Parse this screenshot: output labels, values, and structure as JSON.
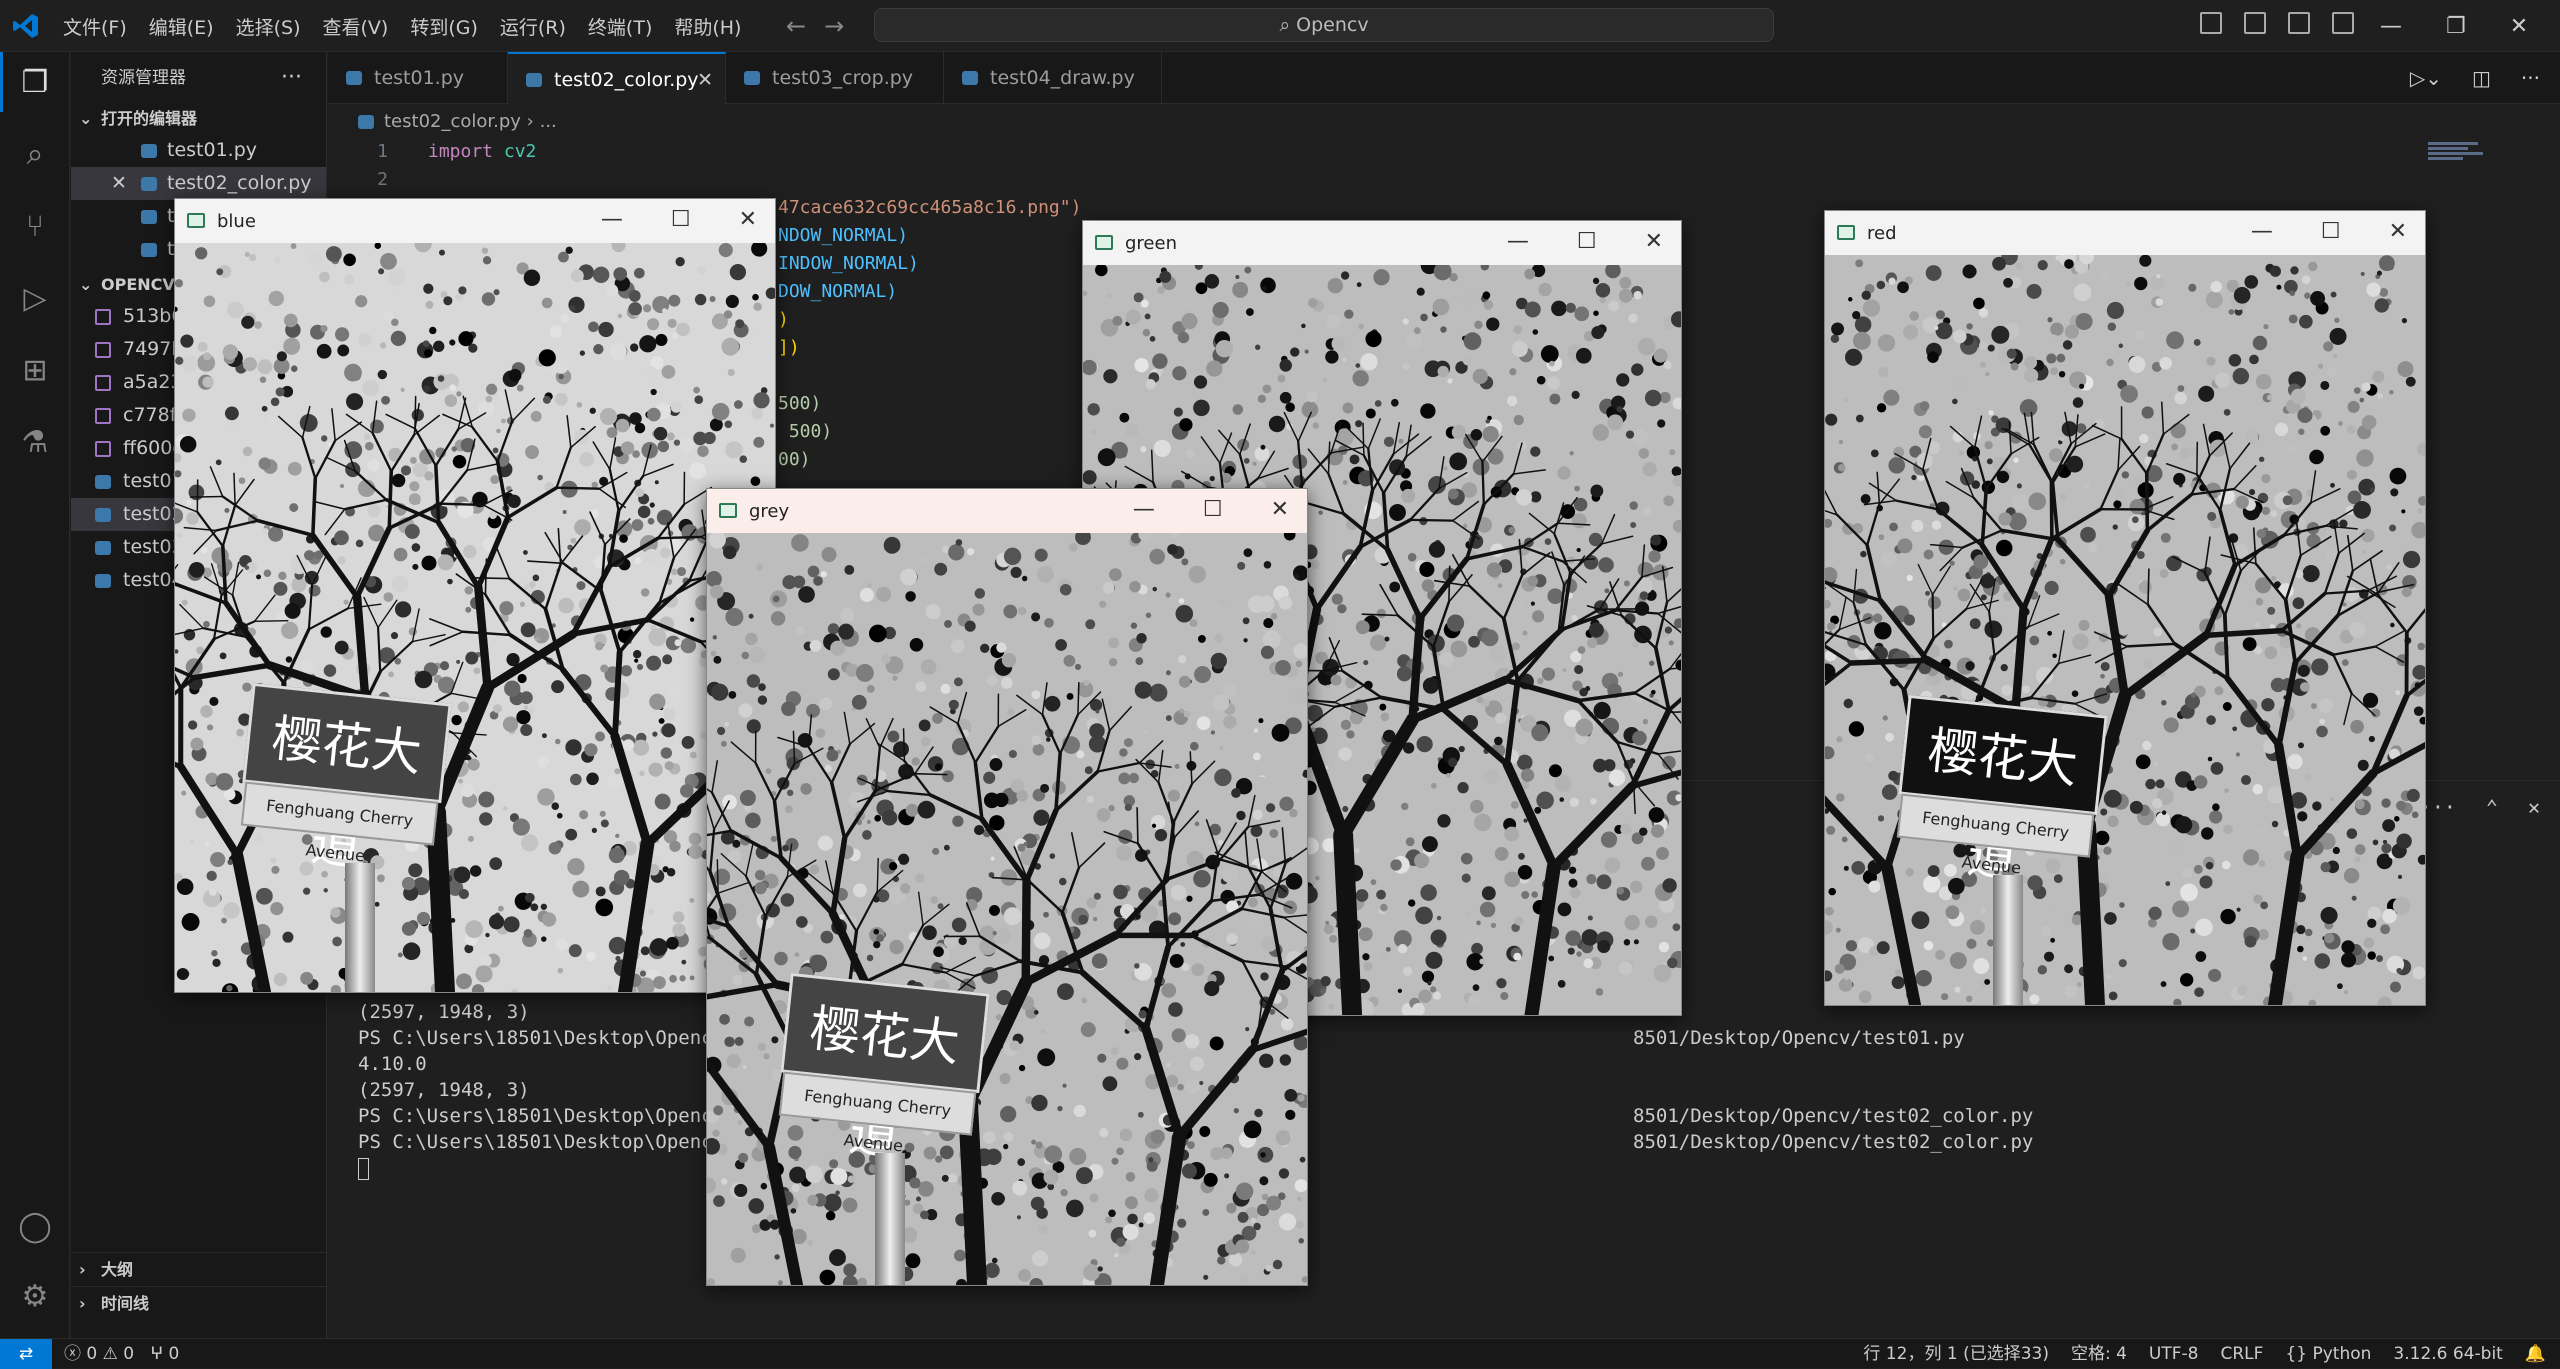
{
  "titlebar": {
    "menu": [
      "文件(F)",
      "编辑(E)",
      "选择(S)",
      "查看(V)",
      "转到(G)",
      "运行(R)",
      "终端(T)",
      "帮助(H)"
    ],
    "search": "Opencv",
    "logo_color": "#0078d4"
  },
  "sidebar": {
    "title": "资源管理器",
    "open_editors_label": "打开的编辑器",
    "open_editors": [
      "test01.py",
      "test02_color.py",
      "t",
      "t"
    ],
    "folder_label": "OPENCV",
    "files": [
      "513b6",
      "7497b",
      "a5a23",
      "c778f",
      "ff600c",
      "test01",
      "test02",
      "test03",
      "test04"
    ],
    "outline_label": "大纲",
    "timeline_label": "时间线"
  },
  "tabs": [
    "test01.py",
    "test02_color.py",
    "test03_crop.py",
    "test04_draw.py"
  ],
  "breadcrumb": {
    "file": "test02_color.py",
    "more": "..."
  },
  "code": {
    "line1_kw": "import",
    "line1_mod": "cv2",
    "line_numbers": [
      "1",
      "2"
    ],
    "fragments": [
      "47cace632c69cc465a8c16.png\")",
      "NDOW_NORMAL)",
      "INDOW_NORMAL)",
      "DOW_NORMAL)",
      ")",
      "])",
      "500)",
      " 500)",
      "00)"
    ]
  },
  "terminal": {
    "left_lines": [
      "(2597, 1948, 3)",
      "PS C:\\Users\\18501\\Desktop\\Opencv",
      "4.10.0",
      "(2597, 1948, 3)",
      "PS C:\\Users\\18501\\Desktop\\Opencv",
      "PS C:\\Users\\18501\\Desktop\\Opencv"
    ],
    "right_lines": [
      "8501/Desktop/Opencv/test01.py",
      "8501/Desktop/Opencv/test02_color.py",
      "8501/Desktop/Opencv/test02_color.py"
    ]
  },
  "windows": {
    "blue": {
      "title": "blue"
    },
    "green": {
      "title": "green"
    },
    "red": {
      "title": "red"
    },
    "grey": {
      "title": "grey"
    },
    "sign_text": "樱花大道",
    "sign_sub": "Fenghuang Cherry Avenue"
  },
  "status": {
    "errors": "0",
    "warnings": "0",
    "ports": "0",
    "position": "行 12，列 1 (已选择33)",
    "spaces": "空格: 4",
    "encoding": "UTF-8",
    "eol": "CRLF",
    "language": "Python",
    "interpreter": "3.12.6 64-bit"
  }
}
